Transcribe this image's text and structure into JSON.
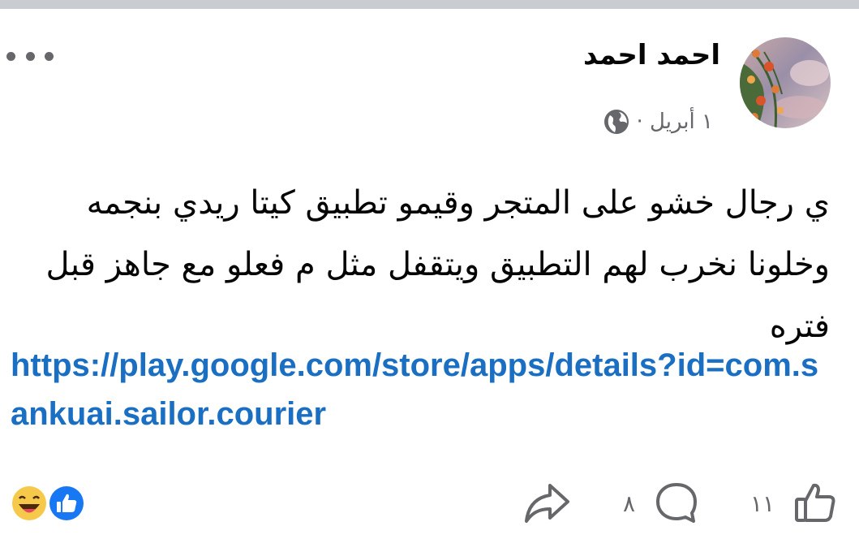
{
  "post": {
    "author": "احمد احمد",
    "date": "١ أبريل ·",
    "privacy_icon": "globe-icon",
    "text": "ي رجال خشو على المتجر وقيمو تطبيق كيتا ريدي بنجمه وخلونا نخرب لهم التطبيق ويتقفل مثل م فعلو مع جاهز قبل فتره",
    "link": "https://play.google.com/store/apps/details?id=com.sankuai.sailor.courier"
  },
  "actions": {
    "like_count": "١١",
    "comment_count": "٨"
  },
  "reactions": [
    "haha-emoji",
    "like-icon"
  ],
  "icons": {
    "more": "more-options-icon",
    "like": "thumbs-up-icon",
    "comment": "comment-icon",
    "share": "share-icon"
  },
  "colors": {
    "link": "#1b6fc3",
    "muted": "#65676b",
    "like_blue": "#1877f2",
    "haha_yellow": "#f7c94b"
  }
}
